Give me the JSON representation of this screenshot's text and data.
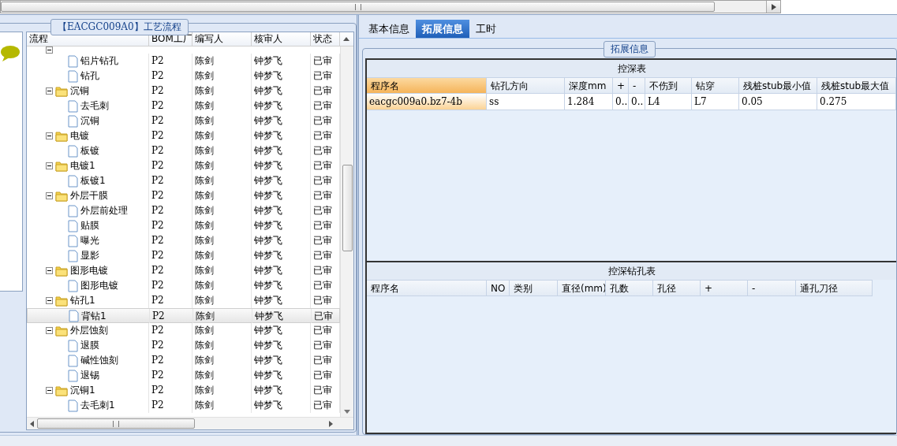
{
  "left_panel": {
    "group_title": "【EACGC009A0】工艺流程",
    "columns": [
      "流程",
      "BOM工厂",
      "编写人",
      "核审人",
      "状态"
    ],
    "tree": [
      {
        "kind": "folder",
        "expanded": true,
        "children": [
          {
            "kind": "file",
            "label": "铝片钻孔",
            "bom": "P2",
            "writer": "陈剑",
            "reviewer": "钟梦飞",
            "status": "已审",
            "selected": false
          },
          {
            "kind": "file",
            "label": "钻孔",
            "bom": "P2",
            "writer": "陈剑",
            "reviewer": "钟梦飞",
            "status": "已审",
            "selected": false
          }
        ]
      },
      {
        "kind": "folder",
        "expanded": true,
        "label": "沉铜",
        "bom": "P2",
        "writer": "陈剑",
        "reviewer": "钟梦飞",
        "status": "已审",
        "selected": false,
        "children": [
          {
            "kind": "file",
            "label": "去毛刺",
            "bom": "P2",
            "writer": "陈剑",
            "reviewer": "钟梦飞",
            "status": "已审",
            "selected": false
          },
          {
            "kind": "file",
            "label": "沉铜",
            "bom": "P2",
            "writer": "陈剑",
            "reviewer": "钟梦飞",
            "status": "已审",
            "selected": false
          }
        ]
      },
      {
        "kind": "folder",
        "expanded": true,
        "label": "电镀",
        "bom": "P2",
        "writer": "陈剑",
        "reviewer": "钟梦飞",
        "status": "已审",
        "selected": false,
        "children": [
          {
            "kind": "file",
            "label": "板镀",
            "bom": "P2",
            "writer": "陈剑",
            "reviewer": "钟梦飞",
            "status": "已审",
            "selected": false
          }
        ]
      },
      {
        "kind": "folder",
        "expanded": true,
        "label": "电镀1",
        "bom": "P2",
        "writer": "陈剑",
        "reviewer": "钟梦飞",
        "status": "已审",
        "selected": false,
        "children": [
          {
            "kind": "file",
            "label": "板镀1",
            "bom": "P2",
            "writer": "陈剑",
            "reviewer": "钟梦飞",
            "status": "已审",
            "selected": false
          }
        ]
      },
      {
        "kind": "folder",
        "expanded": true,
        "label": "外层干膜",
        "bom": "P2",
        "writer": "陈剑",
        "reviewer": "钟梦飞",
        "status": "已审",
        "selected": false,
        "children": [
          {
            "kind": "file",
            "label": "外层前处理",
            "bom": "P2",
            "writer": "陈剑",
            "reviewer": "钟梦飞",
            "status": "已审",
            "selected": false
          },
          {
            "kind": "file",
            "label": "贴膜",
            "bom": "P2",
            "writer": "陈剑",
            "reviewer": "钟梦飞",
            "status": "已审",
            "selected": false
          },
          {
            "kind": "file",
            "label": "曝光",
            "bom": "P2",
            "writer": "陈剑",
            "reviewer": "钟梦飞",
            "status": "已审",
            "selected": false
          },
          {
            "kind": "file",
            "label": "显影",
            "bom": "P2",
            "writer": "陈剑",
            "reviewer": "钟梦飞",
            "status": "已审",
            "selected": false
          }
        ]
      },
      {
        "kind": "folder",
        "expanded": true,
        "label": "图形电镀",
        "bom": "P2",
        "writer": "陈剑",
        "reviewer": "钟梦飞",
        "status": "已审",
        "selected": false,
        "children": [
          {
            "kind": "file",
            "label": "图形电镀",
            "bom": "P2",
            "writer": "陈剑",
            "reviewer": "钟梦飞",
            "status": "已审",
            "selected": false
          }
        ]
      },
      {
        "kind": "folder",
        "expanded": true,
        "label": "钻孔1",
        "bom": "P2",
        "writer": "陈剑",
        "reviewer": "钟梦飞",
        "status": "已审",
        "selected": false,
        "children": [
          {
            "kind": "file",
            "label": "背钻1",
            "bom": "P2",
            "writer": "陈剑",
            "reviewer": "钟梦飞",
            "status": "已审",
            "selected": true
          }
        ]
      },
      {
        "kind": "folder",
        "expanded": true,
        "label": "外层蚀刻",
        "bom": "P2",
        "writer": "陈剑",
        "reviewer": "钟梦飞",
        "status": "已审",
        "selected": false,
        "children": [
          {
            "kind": "file",
            "label": "退膜",
            "bom": "P2",
            "writer": "陈剑",
            "reviewer": "钟梦飞",
            "status": "已审",
            "selected": false
          },
          {
            "kind": "file",
            "label": "碱性蚀刻",
            "bom": "P2",
            "writer": "陈剑",
            "reviewer": "钟梦飞",
            "status": "已审",
            "selected": false
          },
          {
            "kind": "file",
            "label": "退锡",
            "bom": "P2",
            "writer": "陈剑",
            "reviewer": "钟梦飞",
            "status": "已审",
            "selected": false
          }
        ]
      },
      {
        "kind": "folder",
        "expanded": true,
        "label": "沉铜1",
        "bom": "P2",
        "writer": "陈剑",
        "reviewer": "钟梦飞",
        "status": "已审",
        "selected": false,
        "children": [
          {
            "kind": "file",
            "label": "去毛刺1",
            "bom": "P2",
            "writer": "陈剑",
            "reviewer": "钟梦飞",
            "status": "已审",
            "selected": false
          }
        ]
      }
    ]
  },
  "right_panel": {
    "tabs": [
      {
        "label": "基本信息",
        "selected": false
      },
      {
        "label": "拓展信息",
        "selected": true
      },
      {
        "label": "工时",
        "selected": false
      }
    ],
    "group_title": "拓展信息",
    "depth_table": {
      "title": "控深表",
      "columns": [
        "程序名",
        "钻孔方向",
        "深度mm",
        "+",
        "-",
        "不伤到",
        "钻穿",
        "残桩stub最小值",
        "残桩stub最大值"
      ],
      "rows": [
        {
          "cells": [
            "eacgc009a0.bz7-4b",
            "ss",
            "1.284",
            "0..",
            "0..",
            "L4",
            "L7",
            "0.05",
            "0.275"
          ],
          "selected": true
        }
      ]
    },
    "hole_table": {
      "title": "控深钻孔表",
      "columns": [
        "程序名",
        "NO",
        "类别",
        "直径(mm)",
        "孔数",
        "孔径",
        "+",
        "-",
        "通孔刀径"
      ]
    }
  }
}
